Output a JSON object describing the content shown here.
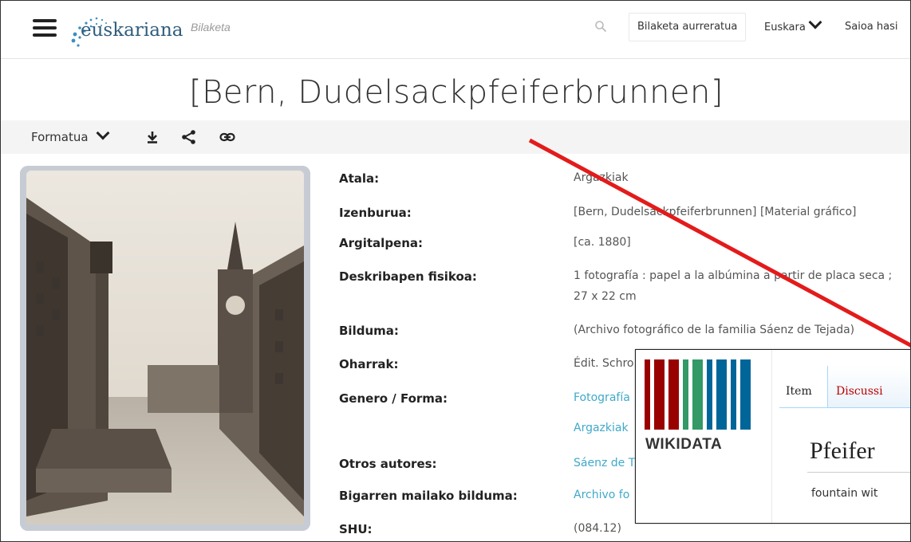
{
  "header": {
    "logo_text": "euskariana",
    "search_placeholder": "Bilaketa",
    "advanced_search": "Bilaketa aurreratua",
    "language": "Euskara",
    "login": "Saioa hasi"
  },
  "title": "[Bern, Dudelsackpfeiferbrunnen]",
  "toolbar": {
    "format_label": "Formatua"
  },
  "record": [
    {
      "label": "Atala:",
      "value": "Argazkiak",
      "link": false
    },
    {
      "label": "Izenburua:",
      "value": "[Bern, Dudelsackpfeiferbrunnen] [Material gráfico]",
      "link": false
    },
    {
      "label": "Argitalpena:",
      "value": "[ca. 1880]",
      "link": false
    },
    {
      "label": "Deskribapen fisikoa:",
      "value": "1 fotografía : papel a la albúmina a partir de placa seca ;",
      "value2": "27 x 22 cm",
      "link": false
    },
    {
      "label": "Bilduma:",
      "value": "(Archivo fotográfico de la familia Sáenz de Tejada)",
      "link": false
    },
    {
      "label": "Oharrak:",
      "value": "Édit. Schro",
      "link": false
    },
    {
      "label": "Genero / Forma:",
      "value": "Fotografía",
      "link": true
    },
    {
      "label": "",
      "value": "Argazkiak",
      "link": true
    },
    {
      "label": "Otros autores:",
      "value": "Sáenz de T",
      "link": true
    },
    {
      "label": "Bigarren mailako bilduma:",
      "value": "Archivo fo",
      "link": true
    },
    {
      "label": "SHU:",
      "value": "(084.12)",
      "link": false
    }
  ],
  "wikidata": {
    "wordmark": "WIKIDATA",
    "tab_item": "Item",
    "tab_discussion": "Discussi",
    "item_title": "Pfeifer",
    "description": "fountain wit"
  },
  "colors": {
    "link": "#3fa9c9",
    "annotation_line": "#e31b1b",
    "toolbar_bg": "#f4f4f4"
  }
}
